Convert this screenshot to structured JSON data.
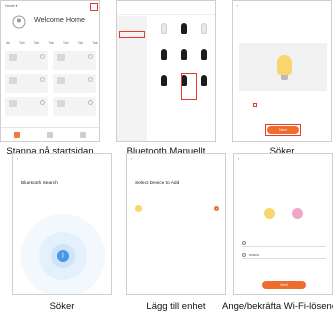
{
  "captions": {
    "p1": "Stanna på startsidan",
    "p2": "Bluetooth Manuellt",
    "p3": "Söker",
    "p4": "Söker",
    "p5": "Lägg till enhet",
    "p6": "Ange/bekräfta Wi-Fi-lösenord"
  },
  "panel1": {
    "title": "Welcome Home",
    "tabs": [
      "All",
      "Tab",
      "Tab",
      "Tab",
      "Tab",
      "Tab",
      "Tab"
    ],
    "devices": [
      "",
      "",
      "",
      "",
      "",
      ""
    ]
  },
  "panel2": {
    "title": "",
    "side": [
      "",
      "",
      "",
      "",
      "",
      "",
      "",
      "",
      "",
      ""
    ],
    "products": [
      "",
      "",
      "",
      "",
      "",
      "",
      "",
      "",
      ""
    ]
  },
  "panel3": {
    "title": "",
    "button": "Next"
  },
  "panel4": {
    "title": "Bluetooth Search"
  },
  "panel5": {
    "title": "Select Device to Add",
    "item": "",
    "add": "+"
  },
  "panel6": {
    "title": "",
    "password_mask": "••••••••",
    "button": "Next"
  },
  "colors": {
    "accent": "#f06c2c",
    "highlight": "#e53b2c",
    "bulb": "#f7d66d",
    "bluetooth": "#4a97e3"
  }
}
